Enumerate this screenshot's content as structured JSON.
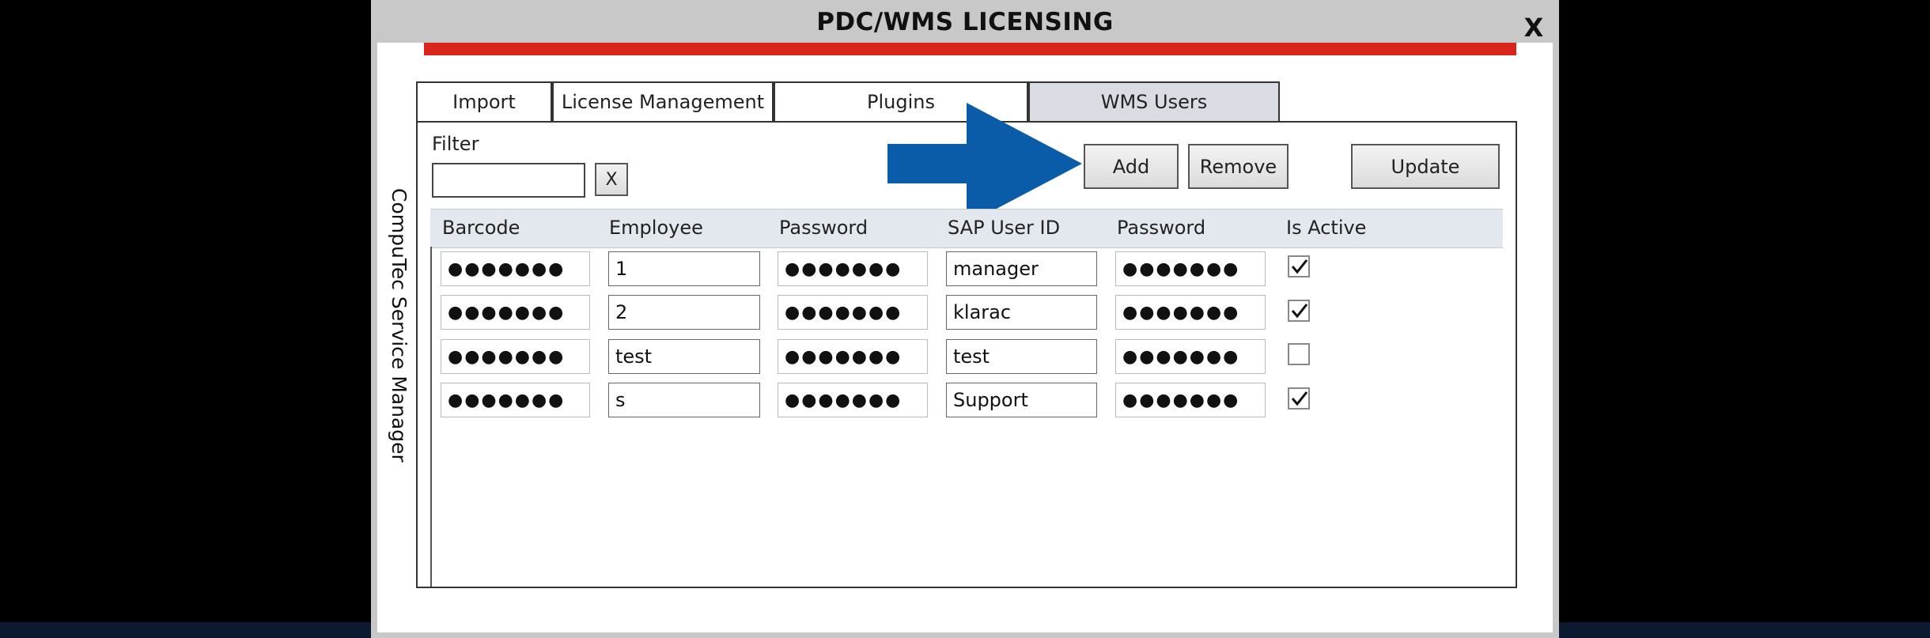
{
  "window": {
    "title": "PDC/WMS LICENSING",
    "close_label": "X",
    "side_label": "CompuTec Service Manager"
  },
  "colors": {
    "accent_bar": "#d9261c",
    "arrow": "#0a5ca8",
    "active_tab": "#d9dde3",
    "grid_header": "#e3e7ee"
  },
  "tabs": [
    {
      "label": "Import",
      "active": false
    },
    {
      "label": "License Management",
      "active": false
    },
    {
      "label": "Plugins",
      "active": false
    },
    {
      "label": "WMS Users",
      "active": true
    }
  ],
  "filter": {
    "label": "Filter",
    "value": "",
    "clear_label": "X"
  },
  "buttons": {
    "add": "Add",
    "remove": "Remove",
    "update": "Update"
  },
  "grid": {
    "columns": [
      "Barcode",
      "Employee",
      "Password",
      "SAP User ID",
      "Password",
      "Is Active"
    ],
    "rows": [
      {
        "barcode": "●●●●●●●",
        "employee": "1",
        "password": "●●●●●●●",
        "sap_user_id": "manager",
        "sap_password": "●●●●●●●",
        "is_active": true
      },
      {
        "barcode": "●●●●●●●",
        "employee": "2",
        "password": "●●●●●●●",
        "sap_user_id": "klarac",
        "sap_password": "●●●●●●●",
        "is_active": true
      },
      {
        "barcode": "●●●●●●●",
        "employee": "test",
        "password": "●●●●●●●",
        "sap_user_id": "test",
        "sap_password": "●●●●●●●",
        "is_active": false
      },
      {
        "barcode": "●●●●●●●",
        "employee": "s",
        "password": "●●●●●●●",
        "sap_user_id": "Support",
        "sap_password": "●●●●●●●",
        "is_active": true
      }
    ]
  }
}
